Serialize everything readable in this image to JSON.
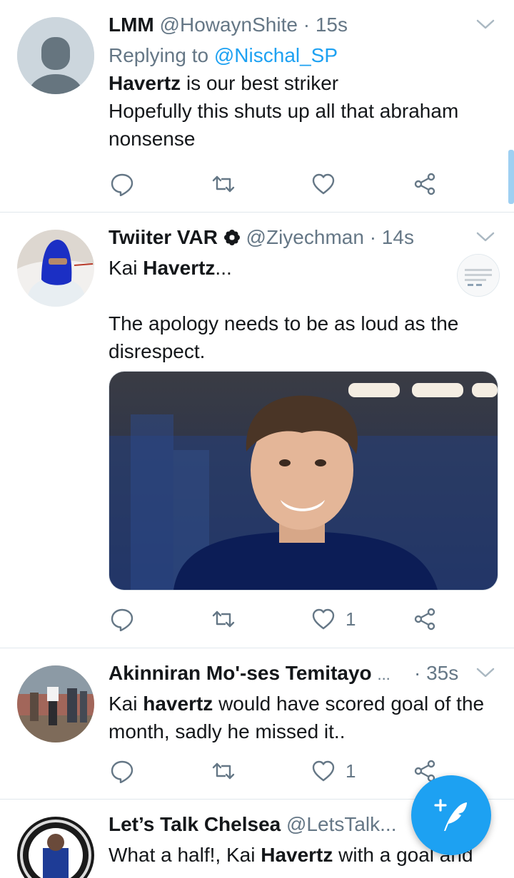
{
  "tweets": [
    {
      "name": "LMM",
      "handle": "@HowaynShite",
      "time": "· 15s",
      "replying_prefix": "Replying to ",
      "replying_to": "@Nischal_SP",
      "line1_bold": "Havertz",
      "line1_rest": " is our best striker",
      "line2": "Hopefully this shuts up all that abraham nonsense",
      "likes": ""
    },
    {
      "name": "Twiiter VAR",
      "handle": "@Ziyechman",
      "time": "· 14s",
      "line1_pre": "Kai ",
      "line1_bold": "Havertz",
      "line1_post": "...",
      "line2": "The apology needs to be as loud as the disrespect.",
      "likes": "1"
    },
    {
      "name": "Akinniran Mo'-ses Temitayo",
      "name_ellipsis": "...",
      "time": "· 35s",
      "line_pre": "Kai ",
      "line_bold": "havertz",
      "line_post": " would have scored goal of the month, sadly he missed it..",
      "likes": "1"
    },
    {
      "name": "Let’s Talk Chelsea",
      "handle": "@LetsTalk...",
      "line_pre": "What a half!, Kai ",
      "line_bold": "Havertz",
      "line_post": " with a goal and"
    }
  ],
  "icons": {
    "reply": "reply-icon",
    "retweet": "retweet-icon",
    "like": "heart-icon",
    "share": "share-icon",
    "compose": "compose-tweet-icon",
    "more": "chevron-down-icon"
  },
  "colors": {
    "accent": "#1da1f2",
    "secondary_text": "#657786",
    "primary_text": "#14171a",
    "divider": "#e1e8ed"
  }
}
